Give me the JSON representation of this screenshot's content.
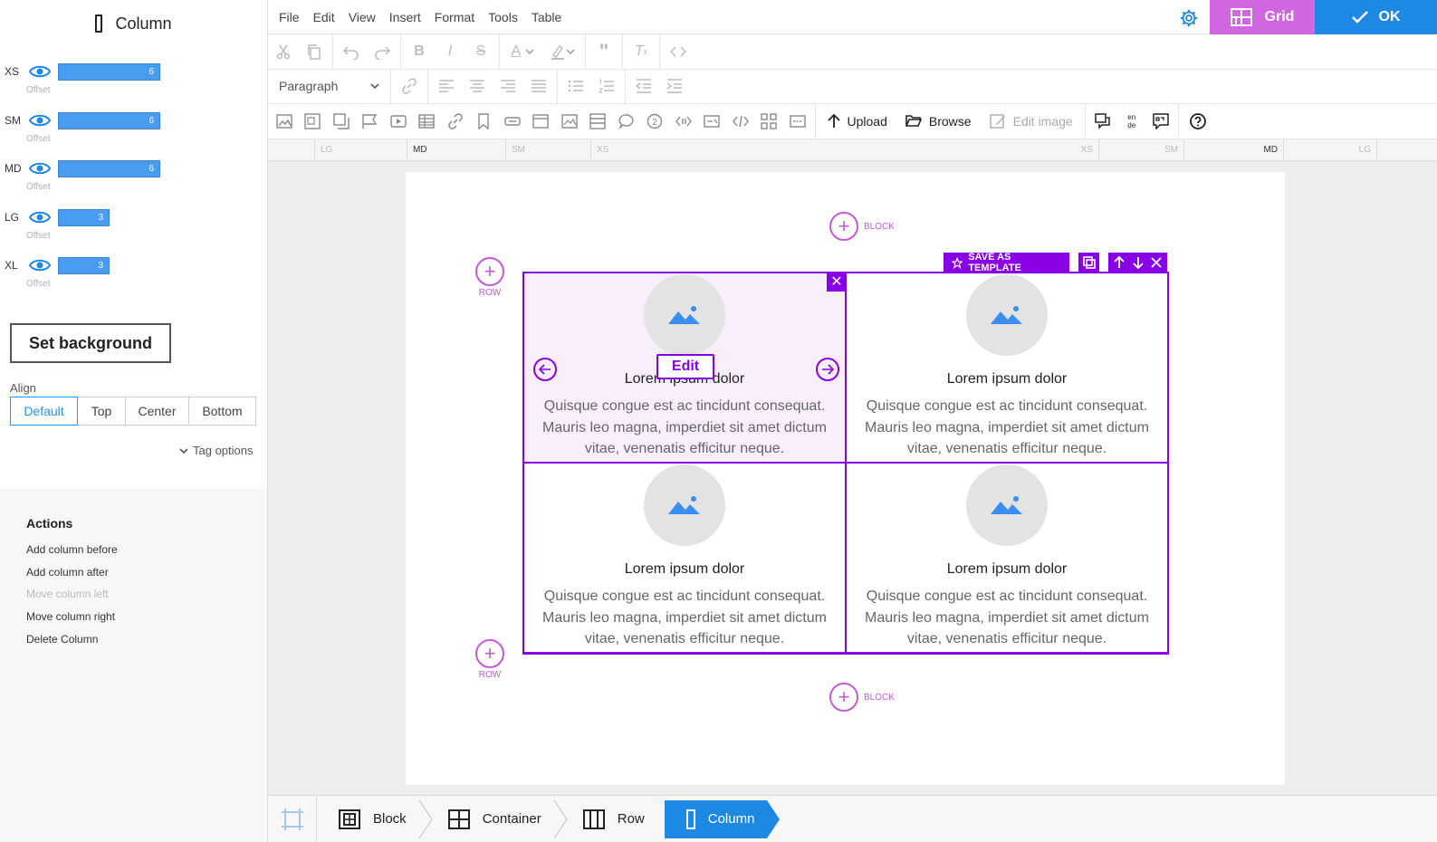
{
  "panel": {
    "title": "Column",
    "sizes": [
      {
        "label": "XS",
        "value": "6",
        "offset_label": "Offset",
        "span": 6
      },
      {
        "label": "SM",
        "value": "6",
        "offset_label": "Offset",
        "span": 6
      },
      {
        "label": "MD",
        "value": "6",
        "offset_label": "Offset",
        "span": 6
      },
      {
        "label": "LG",
        "value": "3",
        "offset_label": "Offset",
        "span": 3
      },
      {
        "label": "XL",
        "value": "3",
        "offset_label": "Offset",
        "span": 3
      }
    ],
    "set_background": "Set background",
    "align_label": "Align",
    "align_options": [
      "Default",
      "Top",
      "Center",
      "Bottom"
    ],
    "align_selected": "Default",
    "tag_options": "Tag options",
    "actions_title": "Actions",
    "actions": [
      "Add column before",
      "Add column after",
      "Move column left",
      "Move column right",
      "Delete Column"
    ]
  },
  "menu": {
    "items": [
      "File",
      "Edit",
      "View",
      "Insert",
      "Format",
      "Tools",
      "Table"
    ],
    "grid_label": "Grid",
    "ok_label": "OK"
  },
  "toolbar": {
    "block_format": "Paragraph",
    "upload": "Upload",
    "browse": "Browse",
    "edit_image": "Edit image",
    "lang_top": "en",
    "lang_bottom": "de"
  },
  "ruler": {
    "left": [
      "LG",
      "MD",
      "SM",
      "XS"
    ],
    "right": [
      "XS",
      "SM",
      "MD",
      "LG"
    ],
    "active": "MD"
  },
  "canvas": {
    "block_label": "BLOCK",
    "row_label": "ROW",
    "save_template": "SAVE AS TEMPLATE",
    "edit_label": "Edit",
    "cells": [
      {
        "title": "Lorem ipsum dolor",
        "text": "Quisque congue est ac tincidunt consequat. Mauris leo magna, imperdiet sit amet dictum vitae, venenatis efficitur neque."
      },
      {
        "title": "Lorem ipsum dolor",
        "text": "Quisque congue est ac tincidunt consequat. Mauris leo magna, imperdiet sit amet dictum vitae, venenatis efficitur neque."
      },
      {
        "title": "Lorem ipsum dolor",
        "text": "Quisque congue est ac tincidunt consequat. Mauris leo magna, imperdiet sit amet dictum vitae, venenatis efficitur neque."
      },
      {
        "title": "Lorem ipsum dolor",
        "text": "Quisque congue est ac tincidunt consequat. Mauris leo magna, imperdiet sit amet dictum vitae, venenatis efficitur neque."
      }
    ]
  },
  "breadcrumb": [
    "Block",
    "Container",
    "Row",
    "Column"
  ],
  "colors": {
    "accent_purple": "#8a00e6",
    "grid_button": "#d066e0",
    "ok_button": "#1e88e5",
    "bar_blue": "#4a9cf0",
    "add_pink": "#c45ad3"
  }
}
